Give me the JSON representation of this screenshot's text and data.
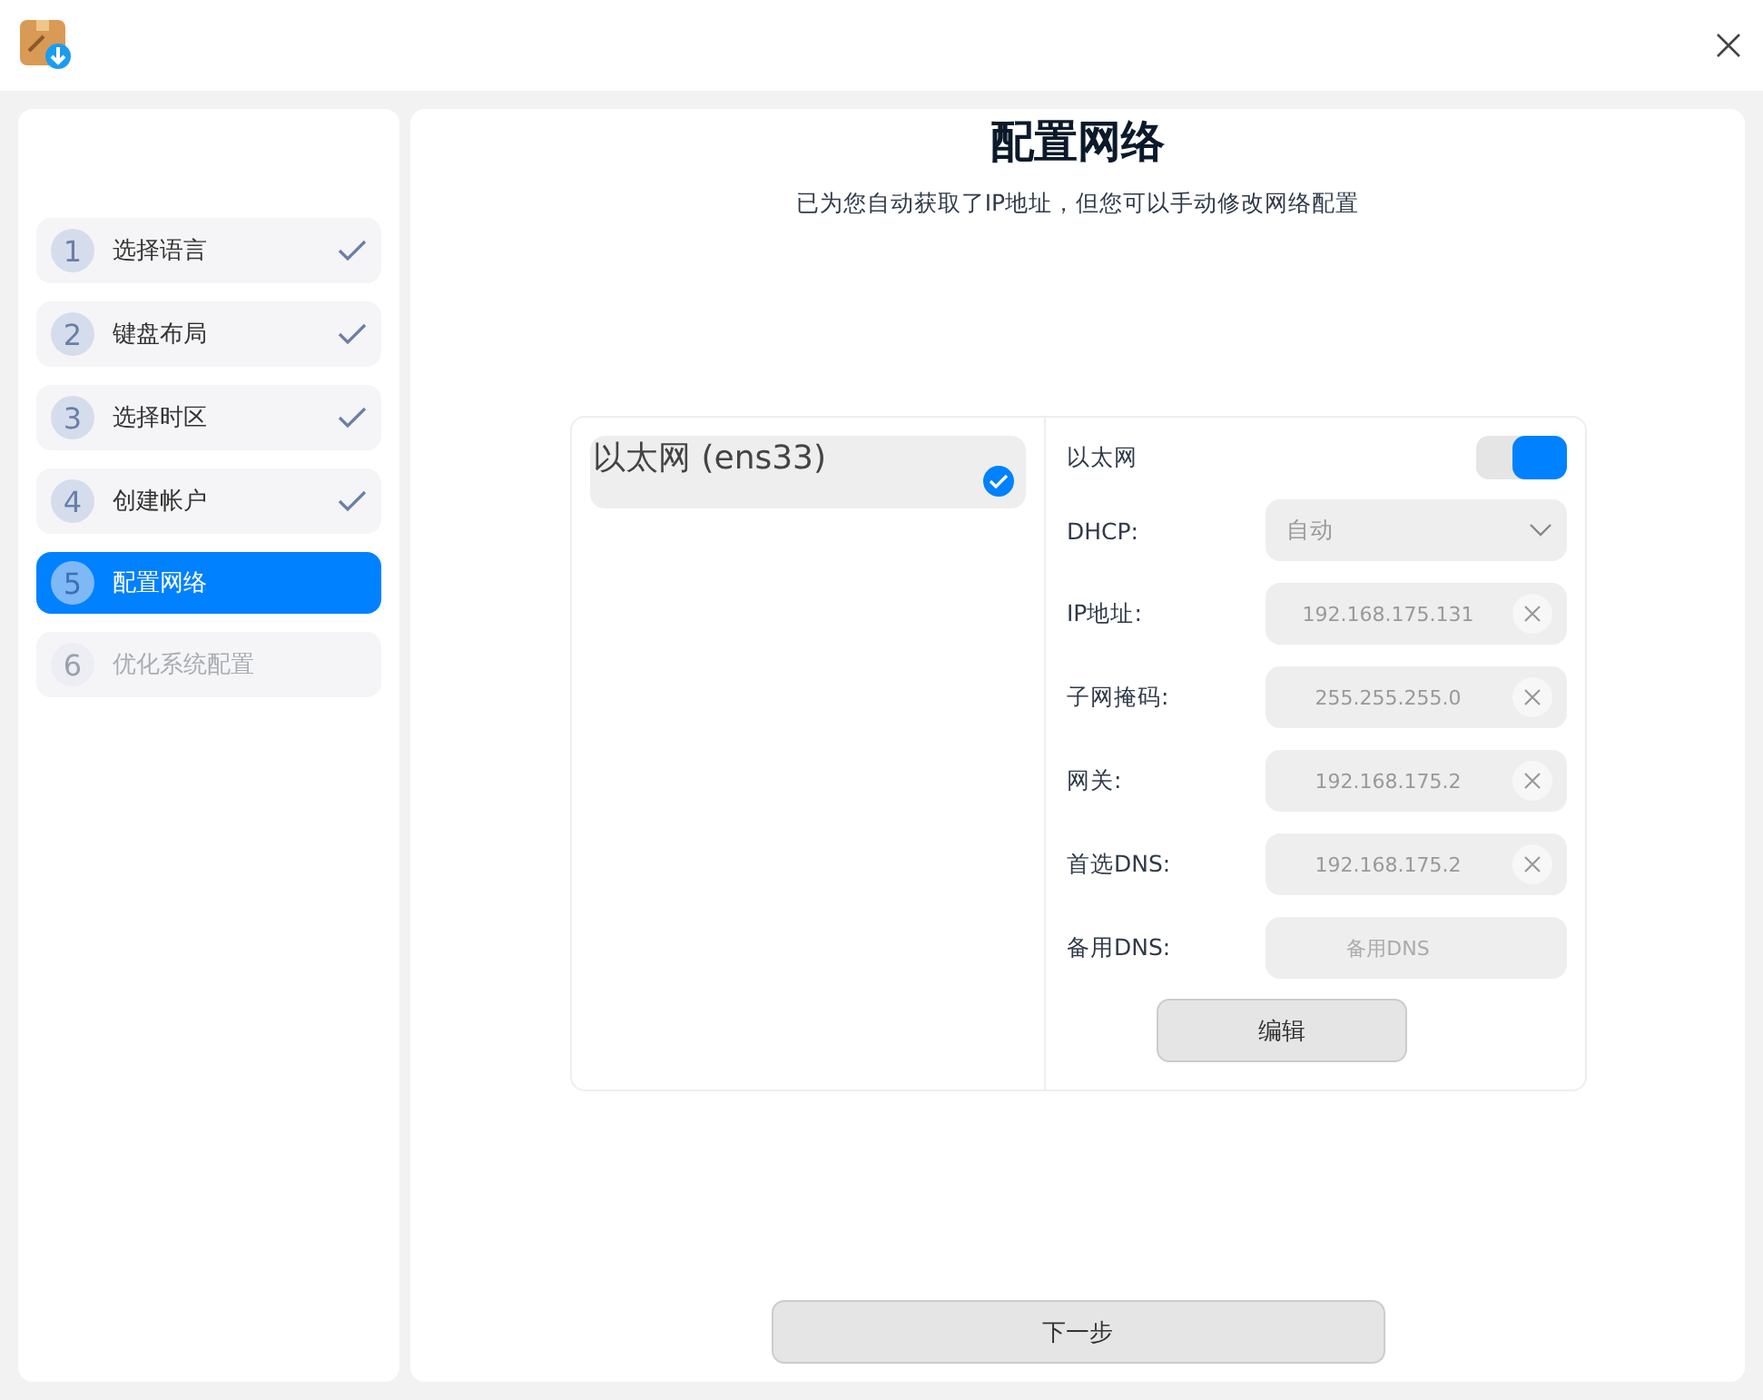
{
  "steps": [
    {
      "number": "1",
      "label": "选择语言",
      "selected": false,
      "done": true,
      "disabled": false
    },
    {
      "number": "2",
      "label": "键盘布局",
      "selected": false,
      "done": true,
      "disabled": false
    },
    {
      "number": "3",
      "label": "选择时区",
      "selected": false,
      "done": true,
      "disabled": false
    },
    {
      "number": "4",
      "label": "创建帐户",
      "selected": false,
      "done": true,
      "disabled": false
    },
    {
      "number": "5",
      "label": "配置网络",
      "selected": true,
      "done": false,
      "disabled": false
    },
    {
      "number": "6",
      "label": "优化系统配置",
      "selected": false,
      "done": false,
      "disabled": true
    }
  ],
  "title": "配置网络",
  "subtitle": "已为您自动获取了IP地址，但您可以手动修改网络配置",
  "connections": [
    {
      "label": "以太网 (ens33)",
      "selected": true
    }
  ],
  "network": {
    "label": "以太网",
    "on": true,
    "fields": [
      {
        "kind": "dropdown",
        "label": "DHCP:",
        "value": "自动"
      },
      {
        "kind": "input",
        "label": "IP地址:",
        "value": "192.168.175.131",
        "clearable": true
      },
      {
        "kind": "input",
        "label": "子网掩码:",
        "value": "255.255.255.0",
        "clearable": true
      },
      {
        "kind": "input",
        "label": "网关:",
        "value": "192.168.175.2",
        "clearable": true
      },
      {
        "kind": "input",
        "label": "首选DNS:",
        "value": "192.168.175.2",
        "clearable": true
      },
      {
        "kind": "input",
        "label": "备用DNS:",
        "placeholder": "备用DNS",
        "clearable": false
      }
    ],
    "edit_button": "编辑"
  },
  "next_button": "下一步"
}
